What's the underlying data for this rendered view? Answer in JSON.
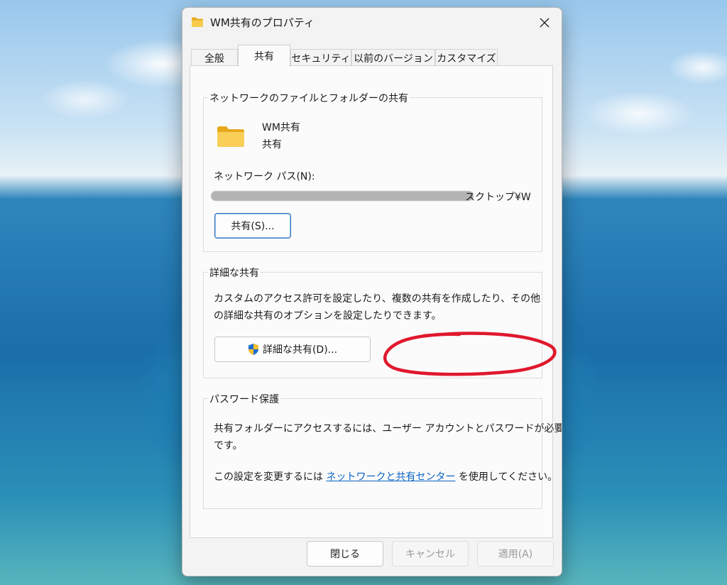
{
  "window": {
    "title": "WM共有のプロパティ",
    "close_glyph": "✕"
  },
  "tabs": [
    {
      "label": "全般",
      "active": false
    },
    {
      "label": "共有",
      "active": true
    },
    {
      "label": "セキュリティ",
      "active": false
    },
    {
      "label": "以前のバージョン",
      "active": false
    },
    {
      "label": "カスタマイズ",
      "active": false
    }
  ],
  "network_sharing": {
    "group_title": "ネットワークのファイルとフォルダーの共有",
    "folder_name": "WM共有",
    "folder_status": "共有",
    "network_path_label": "ネットワーク パス(N):",
    "network_path_visible_tail": "スクトップ¥W",
    "share_button": "共有(S)..."
  },
  "advanced_sharing": {
    "group_title": "詳細な共有",
    "description_line1": "カスタムのアクセス許可を設定したり、複数の共有を作成したり、その他",
    "description_line2": "の詳細な共有のオプションを設定したりできます。",
    "button": "詳細な共有(D)...",
    "annotation_color": "#e0182d"
  },
  "password_protection": {
    "group_title": "パスワード保護",
    "line1": "共有フォルダーにアクセスするには、ユーザー アカウントとパスワードが必要",
    "line2": "です。",
    "line3_prefix": "この設定を変更するには",
    "link": "ネットワークと共有センター",
    "line3_suffix": "を使用してください。"
  },
  "footer": {
    "close": "閉じる",
    "cancel": "キャンセル",
    "apply": "適用(A)"
  },
  "colors": {
    "accent": "#2f6fbd",
    "link": "#0b62c4",
    "folder": "#f6c343"
  },
  "icons": {
    "title_icon": "folder-icon",
    "folder_icon": "folder-icon",
    "close_icon": "close-icon",
    "uac_icon": "uac-shield-icon"
  }
}
